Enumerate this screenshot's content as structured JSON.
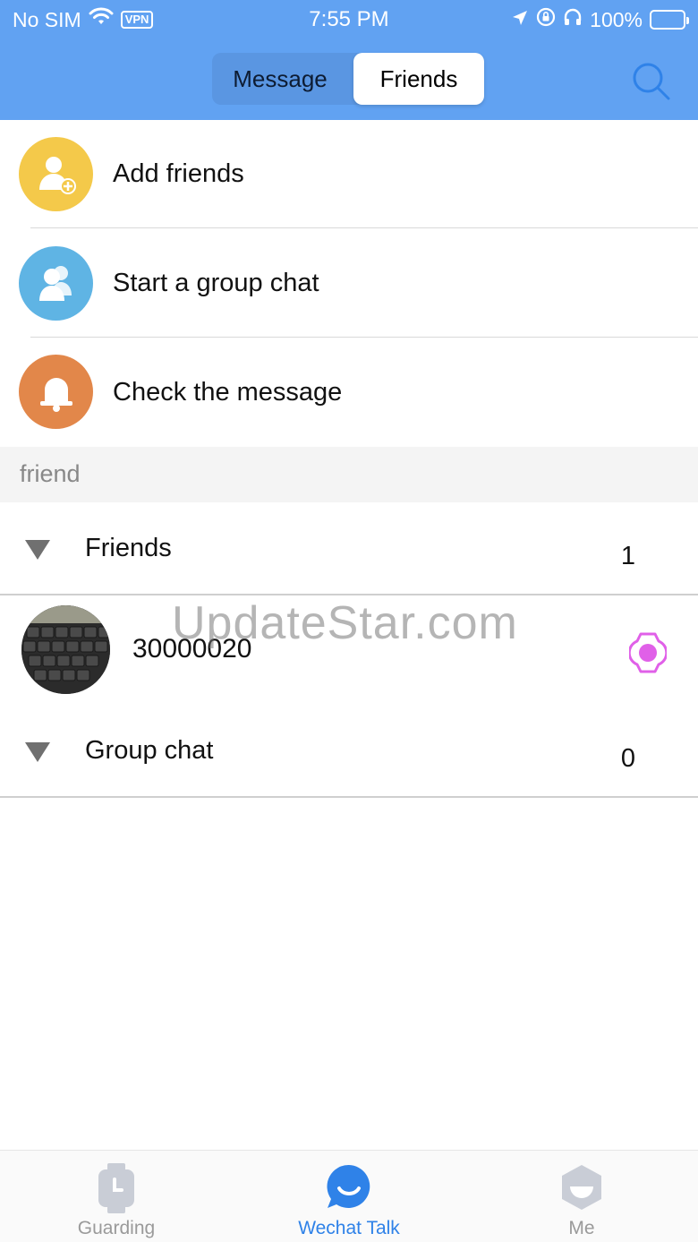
{
  "status_bar": {
    "carrier": "No SIM",
    "vpn": "VPN",
    "time": "7:55 PM",
    "battery": "100%"
  },
  "header": {
    "tabs": [
      {
        "label": "Message",
        "active": false
      },
      {
        "label": "Friends",
        "active": true
      }
    ],
    "search_icon": "search-icon"
  },
  "actions": [
    {
      "label": "Add friends",
      "icon": "add-friend-icon",
      "color": "#f4c94a"
    },
    {
      "label": "Start a group chat",
      "icon": "group-chat-icon",
      "color": "#5fb4e4"
    },
    {
      "label": "Check the message",
      "icon": "bell-icon",
      "color": "#e2874a"
    }
  ],
  "section": {
    "title": "friend"
  },
  "groups": [
    {
      "label": "Friends",
      "count": "1"
    },
    {
      "label": "Group chat",
      "count": "0"
    }
  ],
  "friends": [
    {
      "name": "30000020",
      "device_icon": "watch-icon",
      "device_color": "#e060e8"
    }
  ],
  "watermark": "UpdateStar.com",
  "tabbar": {
    "items": [
      {
        "label": "Guarding",
        "icon": "watch-icon",
        "active": false
      },
      {
        "label": "Wechat Talk",
        "icon": "chat-bubble-icon",
        "active": true
      },
      {
        "label": "Me",
        "icon": "profile-icon",
        "active": false
      }
    ]
  },
  "colors": {
    "header": "#61a2f2",
    "accent": "#2f82e8"
  }
}
